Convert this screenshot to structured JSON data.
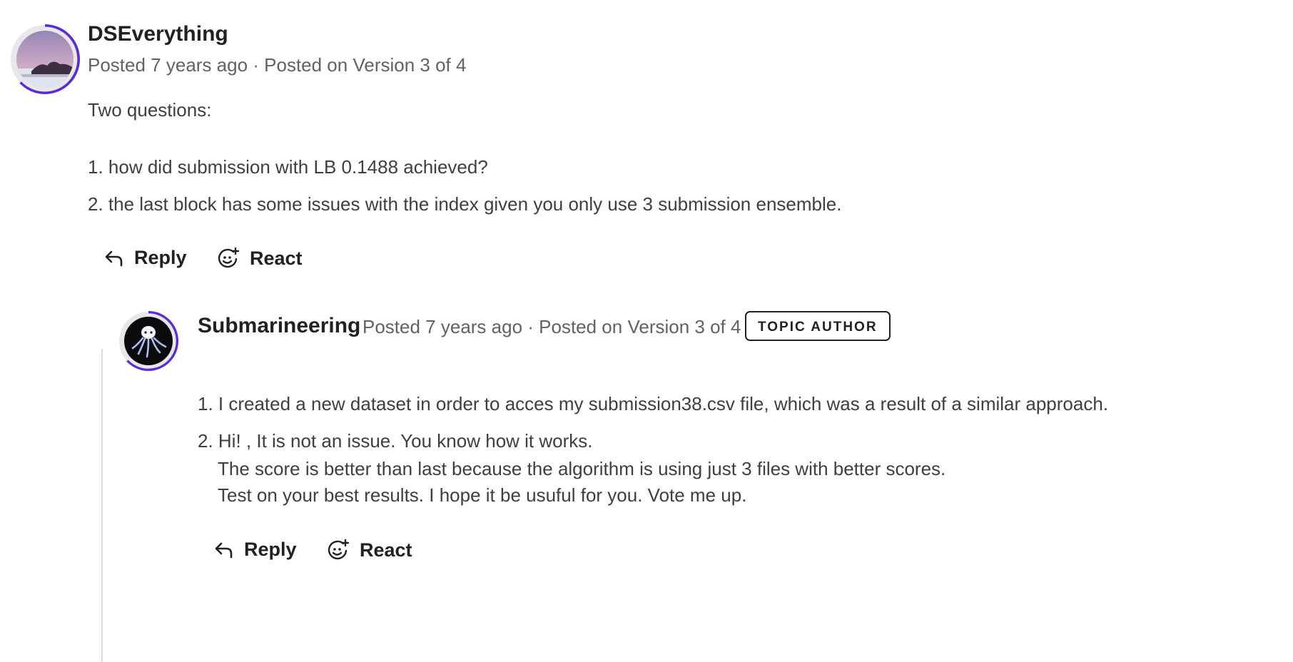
{
  "comment": {
    "author": "DSEverything",
    "meta": "Posted 7 years ago · Posted on Version 3 of 4",
    "intro": "Two questions:",
    "items": [
      "1. how did submission with LB 0.1488 achieved?",
      "2. the last block has some issues with the index given you only use 3 submission ensemble."
    ],
    "actions": {
      "reply": "Reply",
      "react": "React"
    }
  },
  "reply": {
    "author": "Submarineering",
    "meta": "Posted 7 years ago · Posted on Version 3 of 4",
    "badge": "TOPIC AUTHOR",
    "item1": "1. I created a new dataset in order to acces my submission38.csv file, which was a result of a similar approach.",
    "item2_lines": [
      "2. Hi! , It is not an issue. You know how it works.",
      "The score is better than last because the algorithm is using just 3 files with better scores.",
      "Test on your best results. I hope it be usuful for you. Vote me up."
    ],
    "actions": {
      "reply": "Reply",
      "react": "React"
    }
  },
  "colors": {
    "ring": "#5c2bd9",
    "text": "#202124",
    "muted": "#5f6368",
    "line": "#dadce0"
  },
  "icons": [
    "reply-arrow-icon",
    "add-reaction-icon"
  ]
}
